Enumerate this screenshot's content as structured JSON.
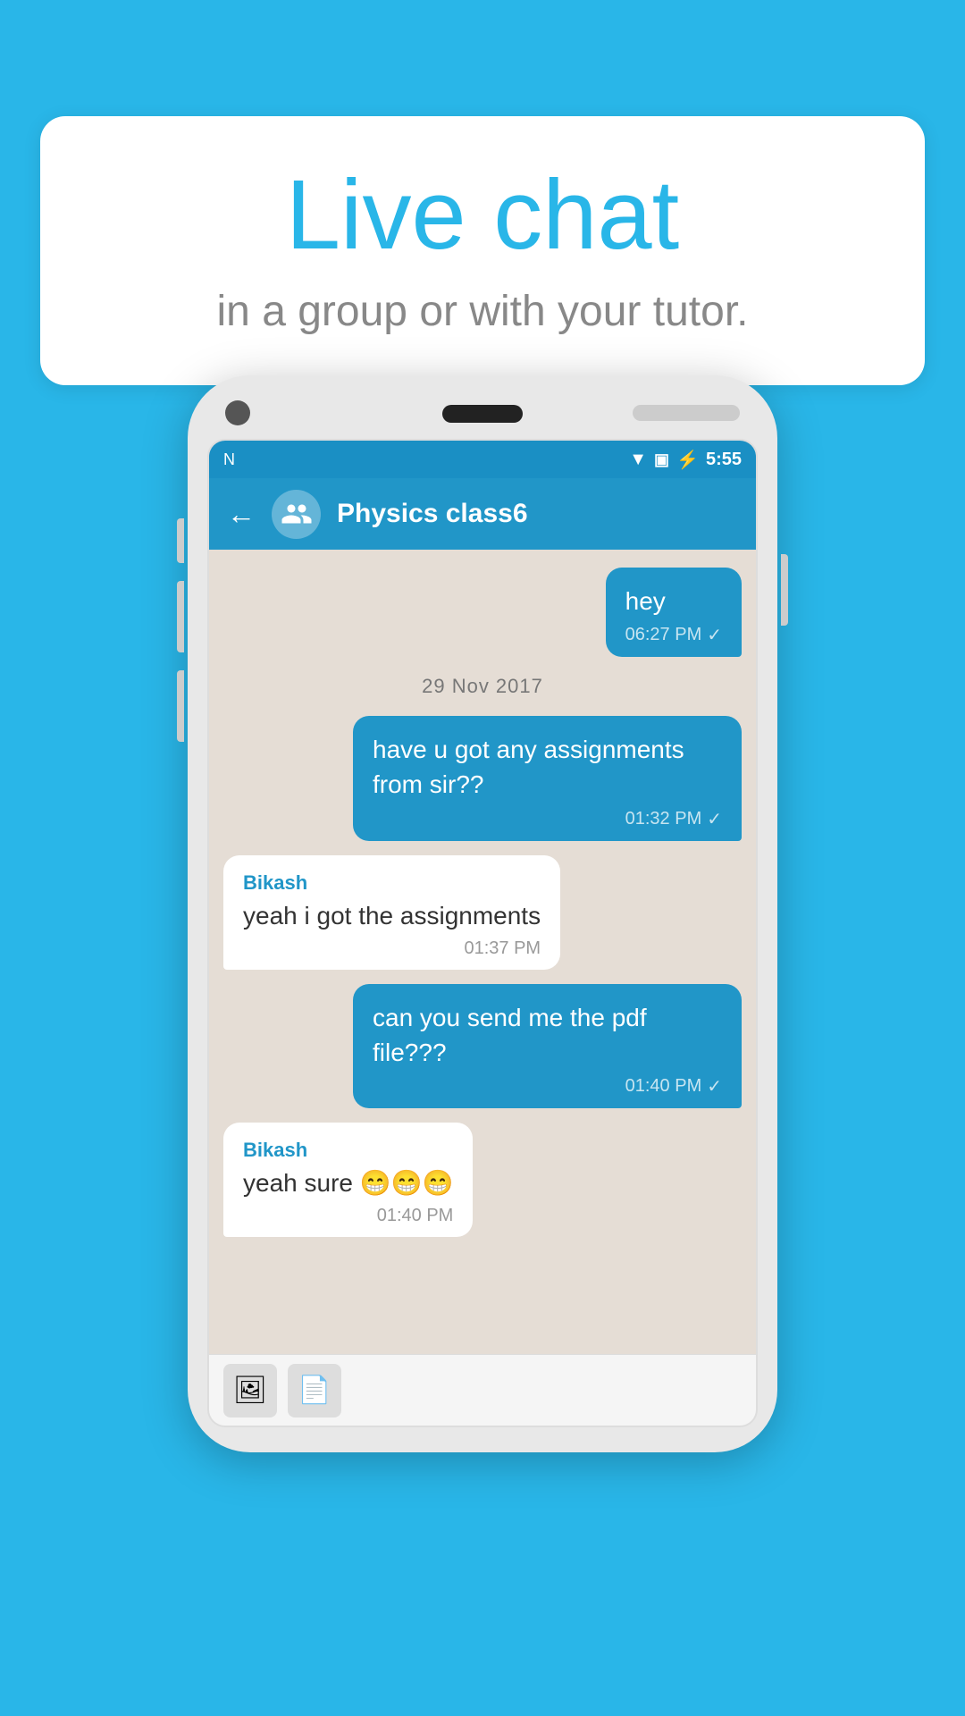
{
  "bubble": {
    "title": "Live chat",
    "subtitle": "in a group or with your tutor."
  },
  "status_bar": {
    "time": "5:55",
    "notification_icon": "N"
  },
  "app_header": {
    "title": "Physics class6",
    "back_label": "←"
  },
  "messages": [
    {
      "id": "msg1",
      "type": "sent",
      "text": "hey",
      "time": "06:27 PM",
      "check": "✓"
    },
    {
      "id": "divider1",
      "type": "divider",
      "text": "29  Nov  2017"
    },
    {
      "id": "msg2",
      "type": "sent",
      "text": "have u got any assignments from sir??",
      "time": "01:32 PM",
      "check": "✓"
    },
    {
      "id": "msg3",
      "type": "received",
      "sender": "Bikash",
      "text": "yeah i got the assignments",
      "time": "01:37 PM"
    },
    {
      "id": "msg4",
      "type": "sent",
      "text": "can you send me the pdf file???",
      "time": "01:40 PM",
      "check": "✓"
    },
    {
      "id": "msg5",
      "type": "received",
      "sender": "Bikash",
      "text": "yeah sure 😁😁😁",
      "time": "01:40 PM"
    }
  ],
  "toolbar": {
    "image_icon": "🖼",
    "doc_icon": "📄"
  }
}
